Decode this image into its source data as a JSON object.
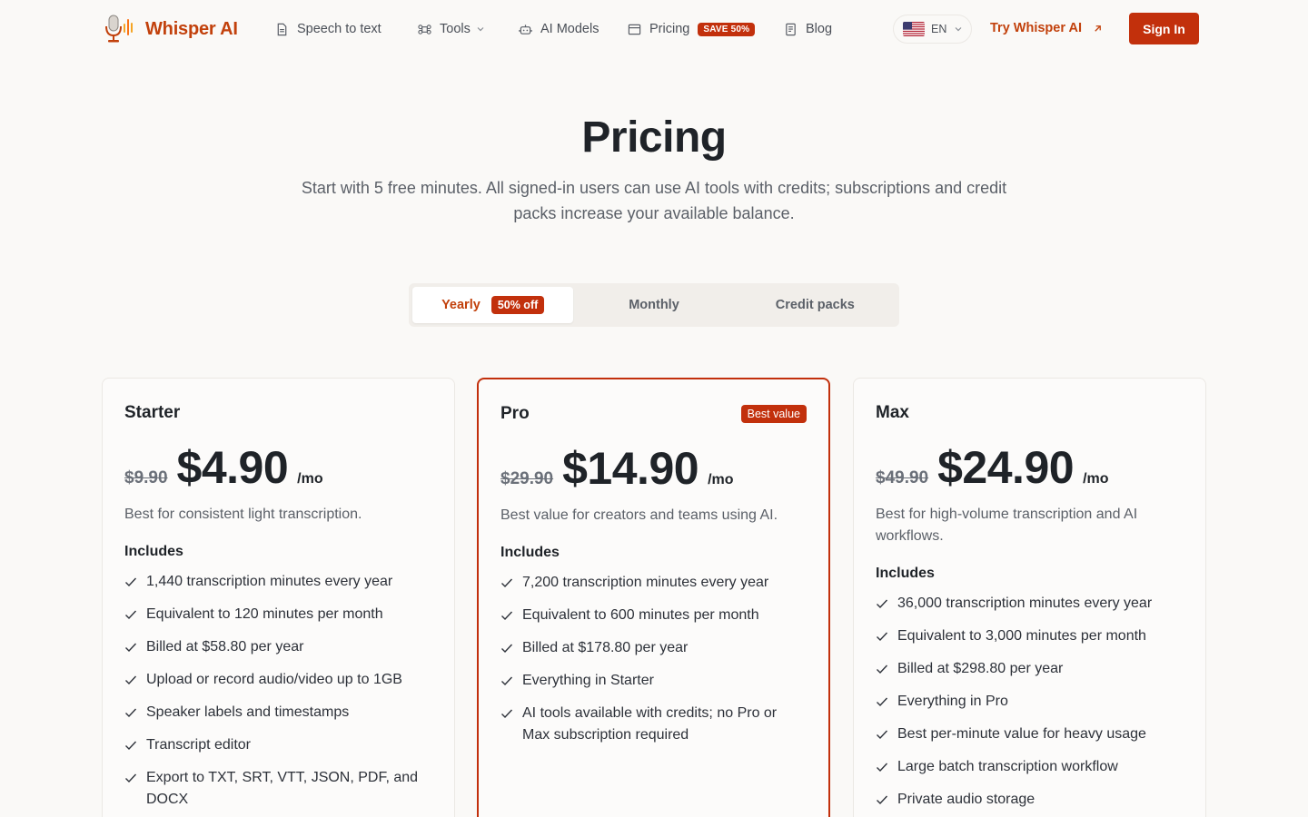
{
  "brand": {
    "name": "Whisper AI",
    "accent": "#c2410c"
  },
  "nav": {
    "items": [
      {
        "label": "Speech to text",
        "icon": "document-icon"
      },
      {
        "label": "Tools",
        "icon": "command-icon"
      },
      {
        "label": "AI Models",
        "icon": "robot-icon"
      },
      {
        "label": "Pricing",
        "icon": "window-icon",
        "badge": "SAVE 50%"
      },
      {
        "label": "Blog",
        "icon": "book-icon"
      }
    ],
    "language": "EN",
    "try_label": "Try Whisper AI",
    "signin_label": "Sign In"
  },
  "hero": {
    "title": "Pricing",
    "subtitle": "Start with 5 free minutes. All signed-in users can use AI tools with credits; subscriptions and credit packs increase your available balance."
  },
  "billing_toggle": {
    "options": [
      "Yearly",
      "Monthly",
      "Credit packs"
    ],
    "selected": "Yearly",
    "yearly_badge": "50% off"
  },
  "plans": [
    {
      "name": "Starter",
      "old_price": "$9.90",
      "price": "$4.90",
      "period": "/mo",
      "description": "Best for consistent light transcription.",
      "includes_label": "Includes",
      "features": [
        "1,440 transcription minutes every year",
        "Equivalent to 120 minutes per month",
        "Billed at $58.80 per year",
        "Upload or record audio/video up to 1GB",
        "Speaker labels and timestamps",
        "Transcript editor",
        "Export to TXT, SRT, VTT, JSON, PDF, and DOCX"
      ]
    },
    {
      "name": "Pro",
      "badge": "Best value",
      "old_price": "$29.90",
      "price": "$14.90",
      "period": "/mo",
      "description": "Best value for creators and teams using AI.",
      "includes_label": "Includes",
      "features": [
        "7,200 transcription minutes every year",
        "Equivalent to 600 minutes per month",
        "Billed at $178.80 per year",
        "Everything in Starter",
        "AI tools available with credits; no Pro or Max subscription required"
      ]
    },
    {
      "name": "Max",
      "old_price": "$49.90",
      "price": "$24.90",
      "period": "/mo",
      "description": "Best for high-volume transcription and AI workflows.",
      "includes_label": "Includes",
      "features": [
        "36,000 transcription minutes every year",
        "Equivalent to 3,000 minutes per month",
        "Billed at $298.80 per year",
        "Everything in Pro",
        "Best per-minute value for heavy usage",
        "Large batch transcription workflow",
        "Private audio storage"
      ]
    }
  ]
}
